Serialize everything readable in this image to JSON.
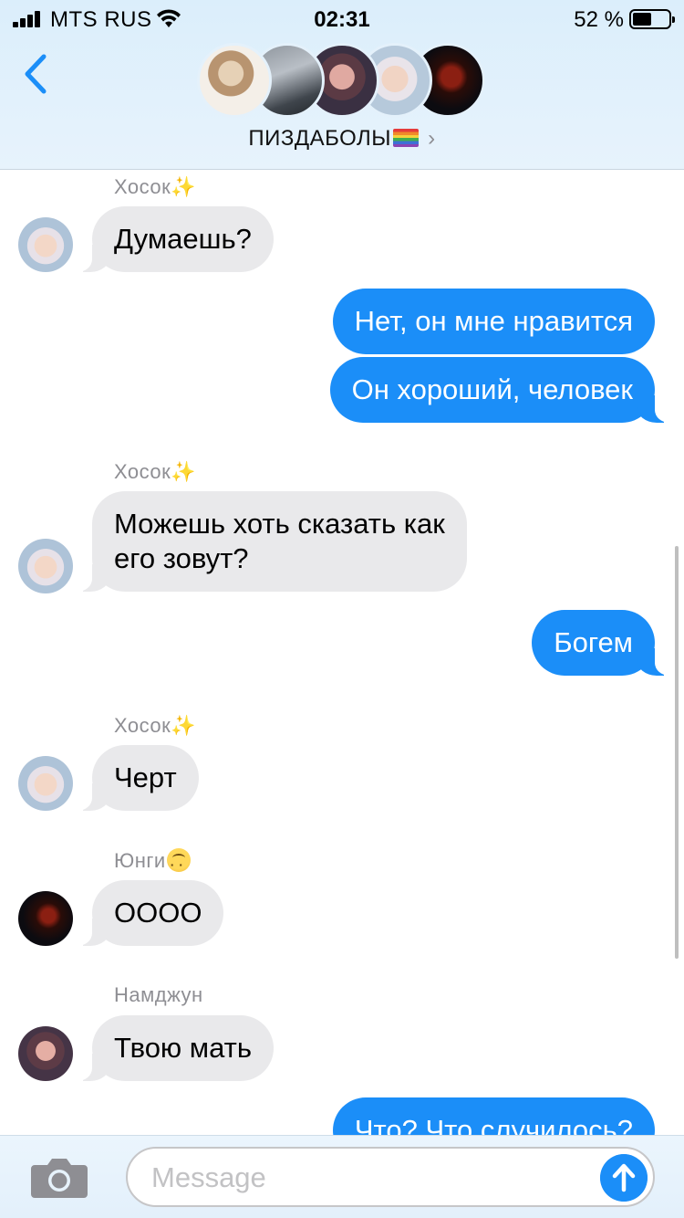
{
  "status_bar": {
    "carrier": "MTS RUS",
    "time": "02:31",
    "battery_percent": "52 %",
    "battery_level": 0.52
  },
  "header": {
    "back_icon": "chevron-left-icon",
    "group_name": "ПИЗДАБОЛЫ",
    "group_name_suffix_icon": "rainbow-flag-icon",
    "disclosure_icon": "chevron-right-icon",
    "member_count_shown": 5
  },
  "messages": [
    {
      "direction": "in",
      "sender": "Хосок",
      "sender_emoji": "✨",
      "text": "Думаешь?"
    },
    {
      "direction": "out",
      "text": "Нет, он мне нравится"
    },
    {
      "direction": "out",
      "text": "Он хороший, человек"
    },
    {
      "direction": "in",
      "sender": "Хосок",
      "sender_emoji": "✨",
      "text_line1": "Можешь хоть сказать как",
      "text_line2": "его зовут?"
    },
    {
      "direction": "out",
      "text": "Богем"
    },
    {
      "direction": "in",
      "sender": "Хосок",
      "sender_emoji": "✨",
      "text": "Черт"
    },
    {
      "direction": "in",
      "sender": "Юнги",
      "sender_emoji_icon": "upside-down-face-icon",
      "text": "ОООО"
    },
    {
      "direction": "in",
      "sender": "Намджун",
      "text": "Твою мать"
    },
    {
      "direction": "out",
      "text": "Что? Что случилось?"
    }
  ],
  "input_bar": {
    "camera_icon": "camera-icon",
    "placeholder": "Message",
    "send_icon": "arrow-up-icon"
  },
  "colors": {
    "accent": "#1b8ef8",
    "incoming_bubble": "#e9e9eb",
    "header_bg": "#dbeefb"
  }
}
